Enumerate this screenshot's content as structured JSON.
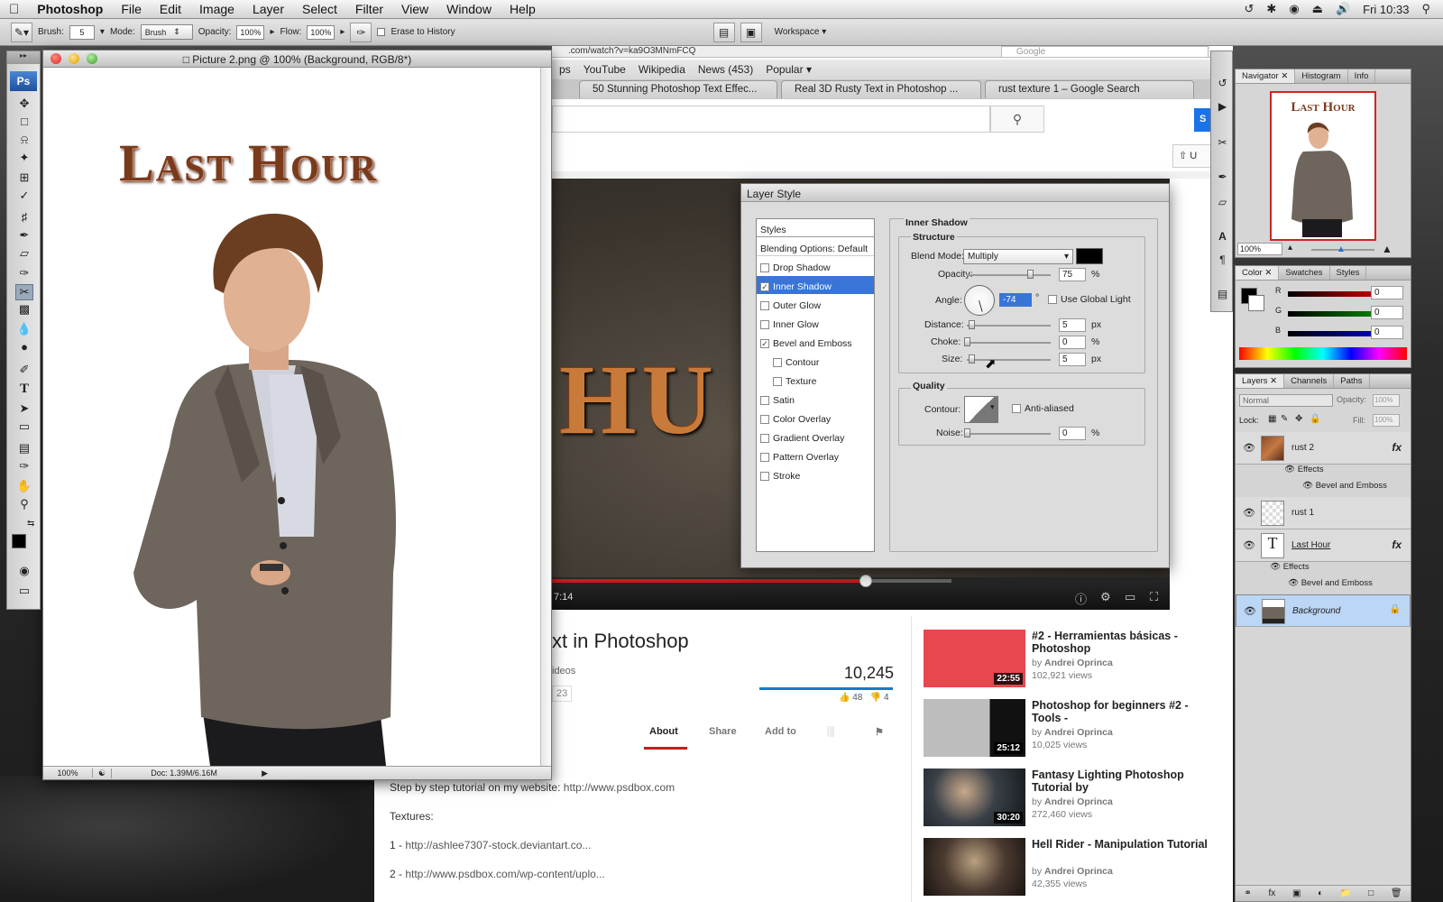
{
  "menubar": {
    "apple": "",
    "app": "Photoshop",
    "menus": [
      "File",
      "Edit",
      "Image",
      "Layer",
      "Select",
      "Filter",
      "View",
      "Window",
      "Help"
    ],
    "clock": "Fri 10:33"
  },
  "options": {
    "brush_label": "Brush:",
    "brush_size": "5",
    "mode_label": "Mode:",
    "mode_value": "Brush",
    "opacity_label": "Opacity:",
    "opacity_value": "100%",
    "flow_label": "Flow:",
    "flow_value": "100%",
    "erase_history": "Erase to History",
    "workspace": "Workspace"
  },
  "browser": {
    "url": ".com/watch?v=ka9O3MNmFCQ",
    "search_placeholder": "Google",
    "bookmarks": [
      "ps",
      "YouTube",
      "Wikipedia",
      "News (453)",
      "Popular"
    ],
    "tabs": [
      "50 Stunning Photoshop Text Effec...",
      "Real 3D Rusty Text in Photoshop ...",
      "rust texture 1 – Google Search"
    ],
    "upload_label": "U",
    "blue_btn": "S"
  },
  "video": {
    "overlay_text": "HU",
    "time": "7:14",
    "title": "xt in Photoshop",
    "sub": "ideos",
    "badge": "23",
    "views": "10,245",
    "likes": "48",
    "dislikes": "4",
    "tabs": [
      "About",
      "Share",
      "Add to"
    ],
    "desc_lines": [
      {
        "text": "Step by step tutorial on my website: ",
        "link": "http://www.psdbox.com"
      },
      {
        "text": "Textures:",
        "link": ""
      },
      {
        "text": "1 - ",
        "link": "http://ashlee7307-stock.deviantart.co..."
      },
      {
        "text": "2 - ",
        "link": "http://www.psdbox.com/wp-content/uplo..."
      }
    ],
    "related": [
      {
        "title": "#2 - Herramientas básicas - Photoshop",
        "author": "Andrei Oprinca",
        "views": "102,921 views",
        "dur": "22:55",
        "color": "#e8474e"
      },
      {
        "title": "Photoshop for beginners #2 - Tools -",
        "author": "Andrei Oprinca",
        "views": "10,025 views",
        "dur": "25:12",
        "color": "#bdbdbd"
      },
      {
        "title": "Fantasy Lighting Photoshop Tutorial by",
        "author": "Andrei Oprinca",
        "views": "272,460 views",
        "dur": "30:20",
        "color": "#3a4048"
      },
      {
        "title": "Hell Rider - Manipulation Tutorial",
        "author": "Andrei Oprinca",
        "views": "42,355 views",
        "dur": "",
        "color": "#4a3a30"
      }
    ],
    "by": "by "
  },
  "document": {
    "title": "Picture 2.png @ 100% (Background, RGB/8*)",
    "headline": "Last Hour",
    "zoom": "100%",
    "doc_size": "Doc: 1.39M/6.16M"
  },
  "toolbox": {
    "ps": "Ps"
  },
  "navigator": {
    "tabs": [
      "Navigator",
      "Histogram",
      "Info"
    ],
    "zoom": "100%",
    "thumb_title": "Last Hour"
  },
  "color_panel": {
    "tabs": [
      "Color",
      "Swatches",
      "Styles"
    ],
    "r_label": "R",
    "g_label": "G",
    "b_label": "B",
    "r": "0",
    "g": "0",
    "b": "0"
  },
  "layers_panel": {
    "tabs": [
      "Layers",
      "Channels",
      "Paths"
    ],
    "blend": "Normal",
    "opacity_label": "Opacity:",
    "opacity": "100%",
    "lock_label": "Lock:",
    "fill_label": "Fill:",
    "fill": "100%",
    "rust2": "rust 2",
    "effects": "Effects",
    "bevel": "Bevel and Emboss",
    "rust1": "rust 1",
    "lasthour": "Last Hour",
    "background": "Background"
  },
  "layer_style": {
    "title": "Layer Style",
    "list": [
      {
        "label": "Styles",
        "check": false,
        "cb": false,
        "active": false,
        "indent": false
      },
      {
        "label": "Blending Options: Default",
        "check": false,
        "cb": false,
        "active": false,
        "indent": false
      },
      {
        "label": "Drop Shadow",
        "check": false,
        "cb": true,
        "active": false,
        "indent": false
      },
      {
        "label": "Inner Shadow",
        "check": true,
        "cb": true,
        "active": true,
        "indent": false
      },
      {
        "label": "Outer Glow",
        "check": false,
        "cb": true,
        "active": false,
        "indent": false
      },
      {
        "label": "Inner Glow",
        "check": false,
        "cb": true,
        "active": false,
        "indent": false
      },
      {
        "label": "Bevel and Emboss",
        "check": true,
        "cb": true,
        "active": false,
        "indent": false
      },
      {
        "label": "Contour",
        "check": false,
        "cb": true,
        "active": false,
        "indent": true
      },
      {
        "label": "Texture",
        "check": false,
        "cb": true,
        "active": false,
        "indent": true
      },
      {
        "label": "Satin",
        "check": false,
        "cb": true,
        "active": false,
        "indent": false
      },
      {
        "label": "Color Overlay",
        "check": false,
        "cb": true,
        "active": false,
        "indent": false
      },
      {
        "label": "Gradient Overlay",
        "check": false,
        "cb": true,
        "active": false,
        "indent": false
      },
      {
        "label": "Pattern Overlay",
        "check": false,
        "cb": true,
        "active": false,
        "indent": false
      },
      {
        "label": "Stroke",
        "check": false,
        "cb": true,
        "active": false,
        "indent": false
      }
    ],
    "section": "Inner Shadow",
    "structure": "Structure",
    "blend_label": "Blend Mode:",
    "blend_value": "Multiply",
    "opacity_label": "Opacity:",
    "opacity_value": "75",
    "angle_label": "Angle:",
    "angle_value": "-74",
    "global_light": "Use Global Light",
    "distance_label": "Distance:",
    "distance_value": "5",
    "choke_label": "Choke:",
    "choke_value": "0",
    "size_label": "Size:",
    "size_value": "5",
    "px": "px",
    "pct": "%",
    "deg": "°",
    "quality": "Quality",
    "contour_label": "Contour:",
    "antialiased": "Anti-aliased",
    "noise_label": "Noise:",
    "noise_value": "0"
  }
}
